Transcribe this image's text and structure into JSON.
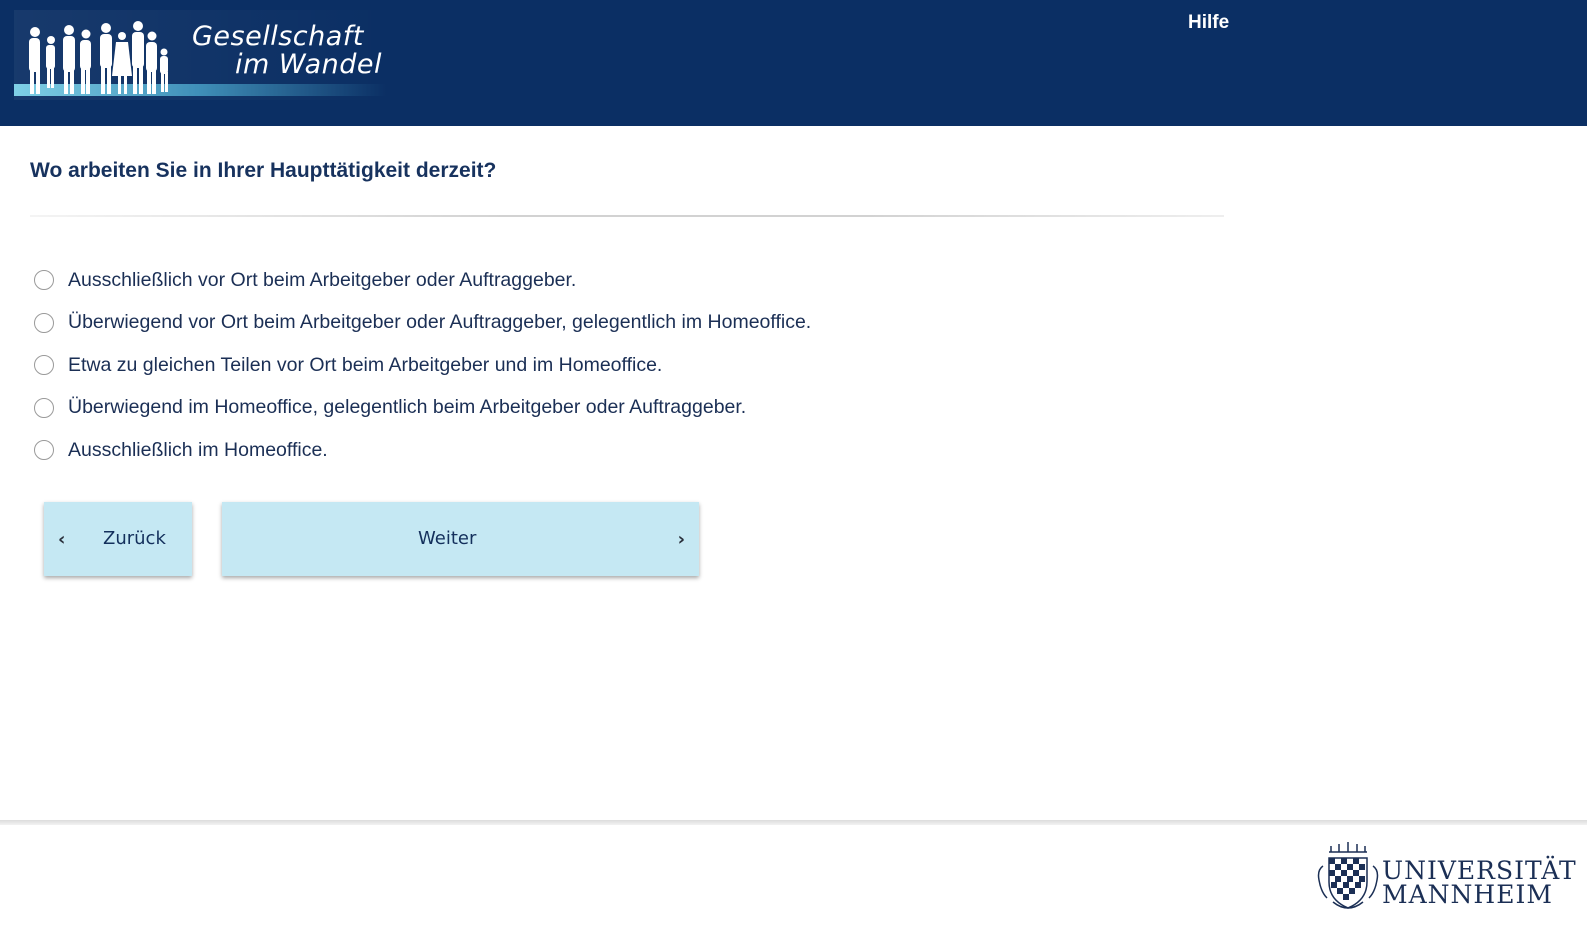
{
  "header": {
    "logo_line1": "Gesellschaft",
    "logo_line2": "im Wandel",
    "help_link": "Hilfe",
    "background_color": "#0b2f64"
  },
  "survey": {
    "question": "Wo arbeiten Sie in Ihrer Haupttätigkeit derzeit?",
    "options": [
      "Ausschließlich vor Ort beim Arbeitgeber oder Auftraggeber.",
      "Überwiegend vor Ort beim Arbeitgeber oder Auftraggeber, gelegentlich im Homeoffice.",
      "Etwa zu gleichen Teilen vor Ort beim Arbeitgeber und im Homeoffice.",
      "Überwiegend im Homeoffice, gelegentlich beim Arbeitgeber oder Auftraggeber.",
      "Ausschließlich im Homeoffice."
    ],
    "selected": null
  },
  "navigation": {
    "back_label": "Zurück",
    "next_label": "Weiter",
    "back_icon": "chevron-left-icon",
    "next_icon": "chevron-right-icon",
    "button_color": "#c5e8f3"
  },
  "footer": {
    "university_line1": "UNIVERSITÄT",
    "university_line2": "MANNHEIM",
    "crest_icon": "university-crest-icon"
  }
}
